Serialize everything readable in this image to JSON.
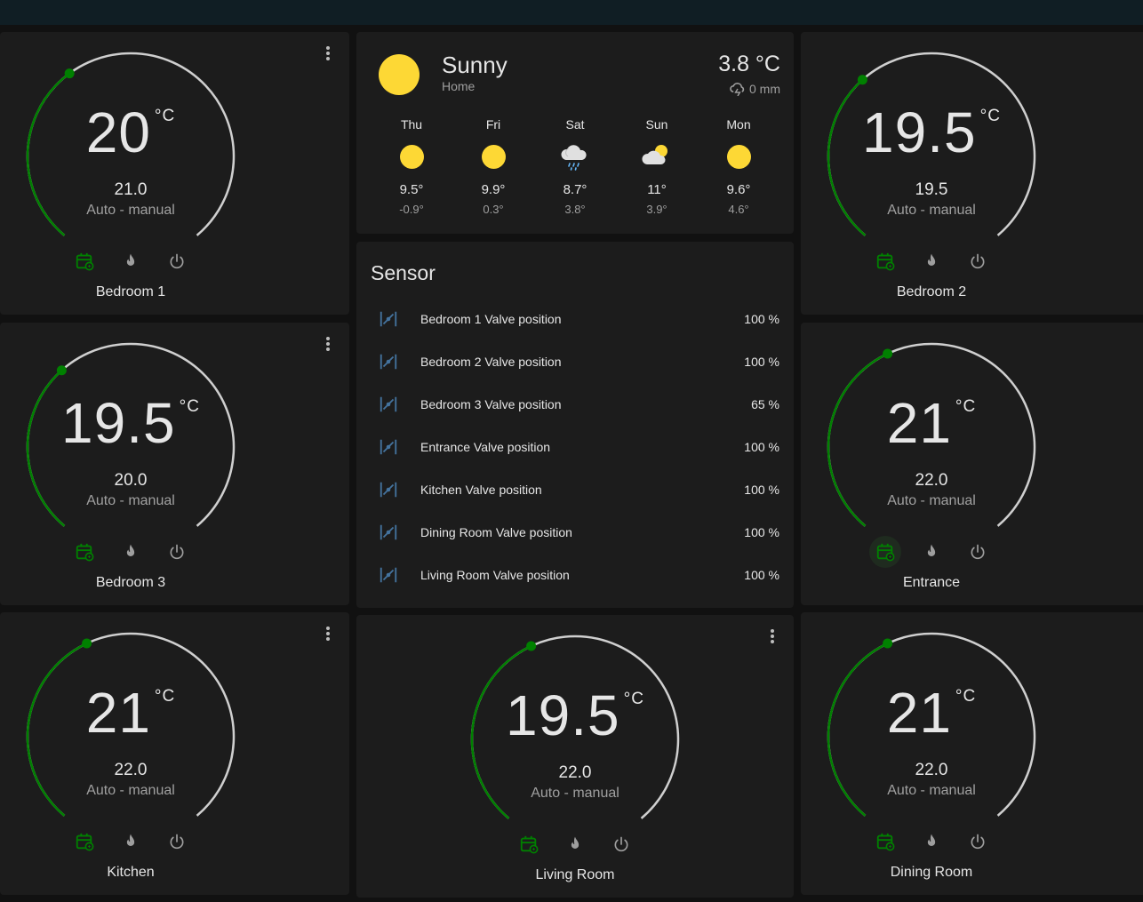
{
  "colors": {
    "accent_green": "#008000",
    "track": "#cfcfcf",
    "sun": "#fdd835",
    "valve_icon": "#44739e"
  },
  "thermostats": [
    {
      "id": "bedroom-1",
      "name": "Bedroom 1",
      "target": "20",
      "unit": "°C",
      "current": "21.0",
      "mode": "Auto - manual",
      "level": 0.37
    },
    {
      "id": "bedroom-3",
      "name": "Bedroom 3",
      "target": "19.5",
      "unit": "°C",
      "current": "20.0",
      "mode": "Auto - manual",
      "level": 0.35
    },
    {
      "id": "kitchen",
      "name": "Kitchen",
      "target": "21",
      "unit": "°C",
      "current": "22.0",
      "mode": "Auto - manual",
      "level": 0.41
    },
    {
      "id": "bedroom-2",
      "name": "Bedroom 2",
      "target": "19.5",
      "unit": "°C",
      "current": "19.5",
      "mode": "Auto - manual",
      "level": 0.35
    },
    {
      "id": "entrance",
      "name": "Entrance",
      "target": "21",
      "unit": "°C",
      "current": "22.0",
      "mode": "Auto - manual",
      "level": 0.41
    },
    {
      "id": "dining-room",
      "name": "Dining Room",
      "target": "21",
      "unit": "°C",
      "current": "22.0",
      "mode": "Auto - manual",
      "level": 0.41
    },
    {
      "id": "living-room",
      "name": "Living Room",
      "target": "19.5",
      "unit": "°C",
      "current": "22.0",
      "mode": "Auto - manual",
      "level": 0.41
    }
  ],
  "thermostat_buttons": [
    "calendar-sync-icon",
    "fire-icon",
    "power-icon"
  ],
  "weather": {
    "condition": "Sunny",
    "location": "Home",
    "temperature": "3.8 °C",
    "precipitation": "0 mm",
    "forecast": [
      {
        "day": "Thu",
        "icon": "sunny",
        "high": "9.5°",
        "low": "-0.9°"
      },
      {
        "day": "Fri",
        "icon": "sunny",
        "high": "9.9°",
        "low": "0.3°"
      },
      {
        "day": "Sat",
        "icon": "rainy",
        "high": "8.7°",
        "low": "3.8°"
      },
      {
        "day": "Sun",
        "icon": "partly-cloudy",
        "high": "11°",
        "low": "3.9°"
      },
      {
        "day": "Mon",
        "icon": "sunny",
        "high": "9.6°",
        "low": "4.6°"
      }
    ]
  },
  "sensor": {
    "title": "Sensor",
    "rows": [
      {
        "label": "Bedroom 1 Valve position",
        "value": "100 %"
      },
      {
        "label": "Bedroom 2 Valve position",
        "value": "100 %"
      },
      {
        "label": "Bedroom 3 Valve position",
        "value": "65 %"
      },
      {
        "label": "Entrance Valve position",
        "value": "100 %"
      },
      {
        "label": "Kitchen Valve position",
        "value": "100 %"
      },
      {
        "label": "Dining Room Valve position",
        "value": "100 %"
      },
      {
        "label": "Living Room Valve position",
        "value": "100 %"
      }
    ]
  }
}
